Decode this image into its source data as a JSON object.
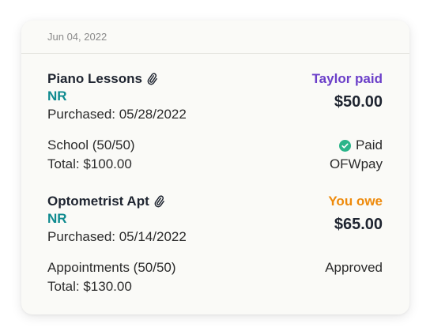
{
  "header": {
    "date": "Jun 04, 2022"
  },
  "entries": [
    {
      "title": "Piano Lessons",
      "tag": "NR",
      "purchased": "Purchased: 05/28/2022",
      "category": "School (50/50)",
      "total": "Total: $100.00",
      "payer": "Taylor paid",
      "amount": "$50.00",
      "status": "Paid",
      "method": "OFWpay"
    },
    {
      "title": "Optometrist Apt",
      "tag": "NR",
      "purchased": "Purchased: 05/14/2022",
      "category": "Appointments (50/50)",
      "total": "Total: $130.00",
      "payer": "You owe",
      "amount": "$65.00",
      "status": "Approved"
    }
  ],
  "colors": {
    "teal": "#0e8a8f",
    "purple": "#6b3fc9",
    "orange": "#ee8a0b",
    "check_green": "#2bb58a"
  },
  "icons": {
    "attachment": "paperclip-icon",
    "paid": "check-circle-icon"
  }
}
